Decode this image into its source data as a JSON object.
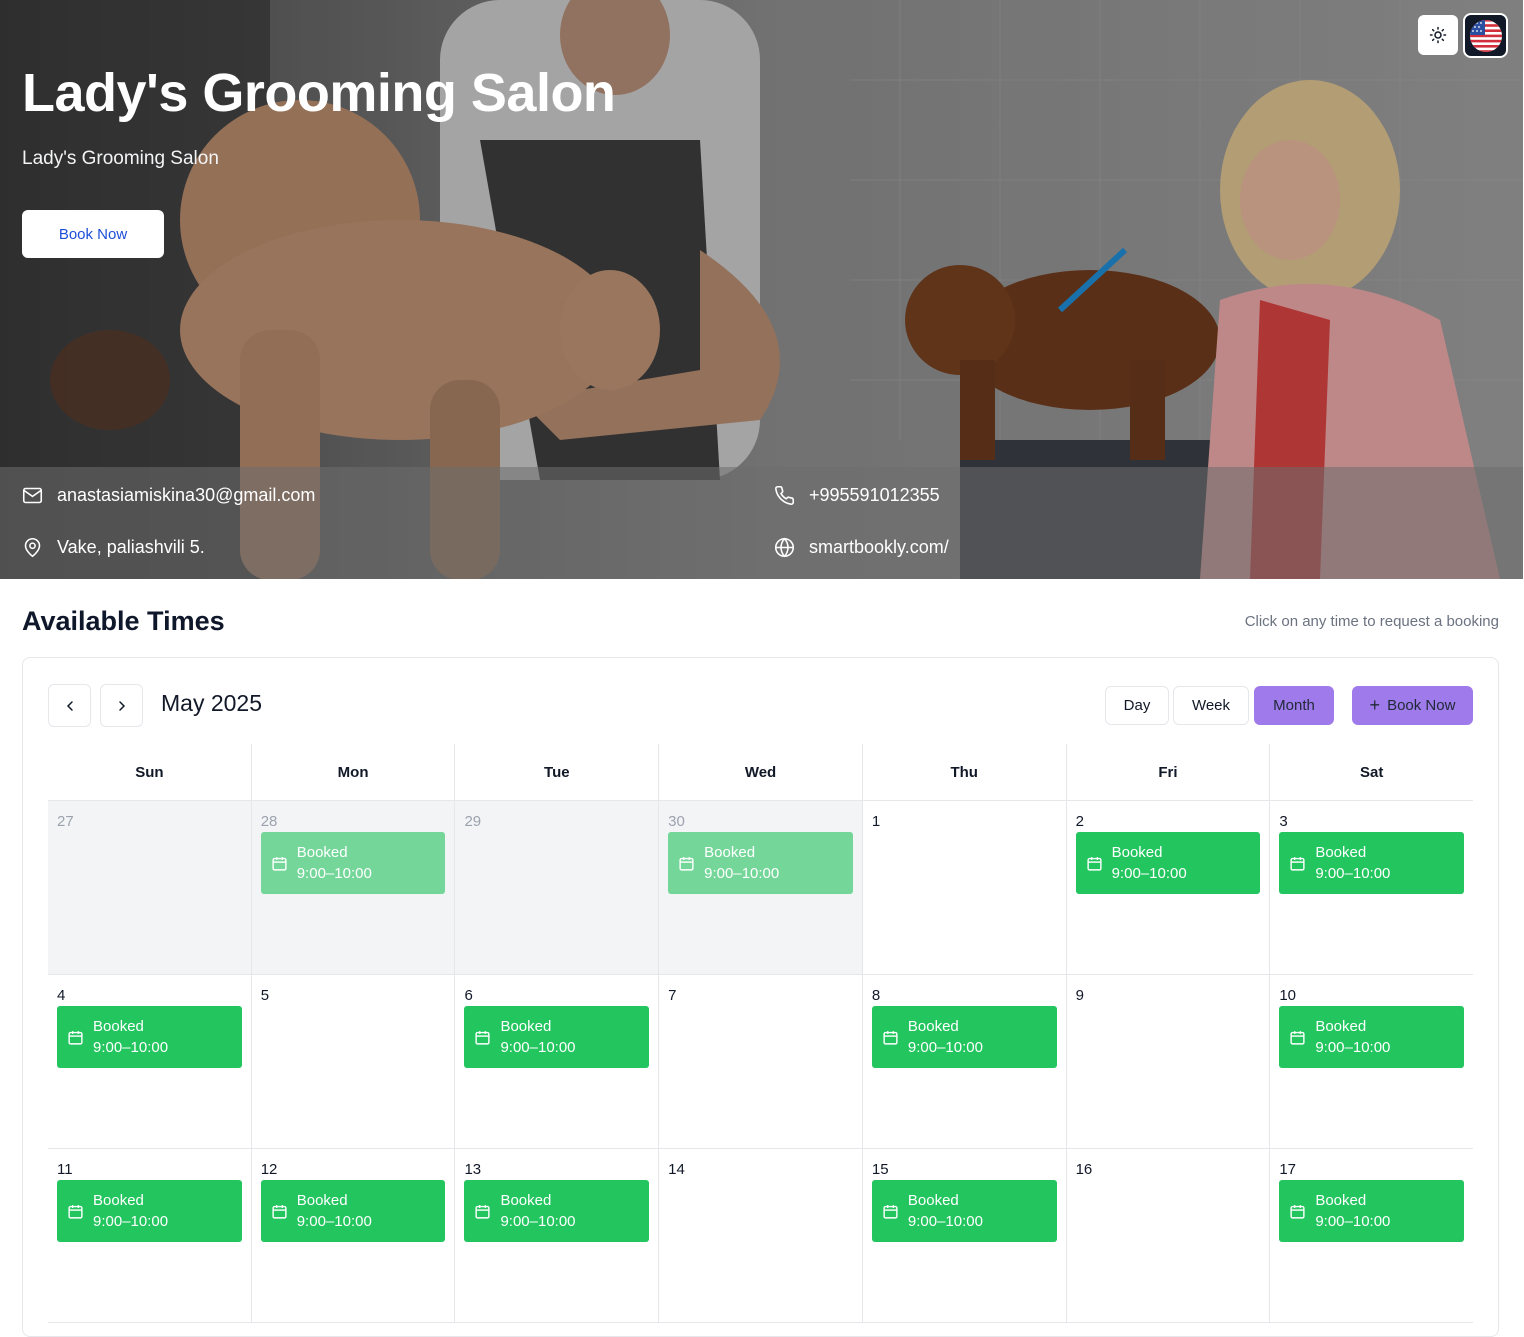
{
  "hero": {
    "title": "Lady's Grooming Salon",
    "subtitle": "Lady's Grooming Salon",
    "book_label": "Book Now"
  },
  "top_controls": {
    "theme_icon": "sun-icon",
    "language_icon": "us-flag-icon"
  },
  "contact": {
    "email": "anastasiamiskina30@gmail.com",
    "phone": "+995591012355",
    "address": "Vake, paliashvili 5.",
    "website": "smartbookly.com/"
  },
  "availability": {
    "title": "Available Times",
    "hint": "Click on any time to request a booking"
  },
  "calendar": {
    "month_label": "May 2025",
    "views": [
      "Day",
      "Week",
      "Month"
    ],
    "active_view": "Month",
    "add_label": "Book Now",
    "weekdays": [
      "Sun",
      "Mon",
      "Tue",
      "Wed",
      "Thu",
      "Fri",
      "Sat"
    ],
    "weeks": [
      [
        {
          "day": "27",
          "other": true,
          "event": null
        },
        {
          "day": "28",
          "other": true,
          "event": {
            "title": "Booked",
            "time": "9:00–10:00"
          }
        },
        {
          "day": "29",
          "other": true,
          "event": null
        },
        {
          "day": "30",
          "other": true,
          "event": {
            "title": "Booked",
            "time": "9:00–10:00"
          }
        },
        {
          "day": "1",
          "other": false,
          "event": null
        },
        {
          "day": "2",
          "other": false,
          "event": {
            "title": "Booked",
            "time": "9:00–10:00"
          }
        },
        {
          "day": "3",
          "other": false,
          "event": {
            "title": "Booked",
            "time": "9:00–10:00"
          }
        }
      ],
      [
        {
          "day": "4",
          "other": false,
          "event": {
            "title": "Booked",
            "time": "9:00–10:00"
          }
        },
        {
          "day": "5",
          "other": false,
          "event": null
        },
        {
          "day": "6",
          "other": false,
          "event": {
            "title": "Booked",
            "time": "9:00–10:00"
          }
        },
        {
          "day": "7",
          "other": false,
          "event": null
        },
        {
          "day": "8",
          "other": false,
          "event": {
            "title": "Booked",
            "time": "9:00–10:00"
          }
        },
        {
          "day": "9",
          "other": false,
          "event": null
        },
        {
          "day": "10",
          "other": false,
          "event": {
            "title": "Booked",
            "time": "9:00–10:00"
          }
        }
      ],
      [
        {
          "day": "11",
          "other": false,
          "event": {
            "title": "Booked",
            "time": "9:00–10:00"
          }
        },
        {
          "day": "12",
          "other": false,
          "event": {
            "title": "Booked",
            "time": "9:00–10:00"
          }
        },
        {
          "day": "13",
          "other": false,
          "event": {
            "title": "Booked",
            "time": "9:00–10:00"
          }
        },
        {
          "day": "14",
          "other": false,
          "event": null
        },
        {
          "day": "15",
          "other": false,
          "event": {
            "title": "Booked",
            "time": "9:00–10:00"
          }
        },
        {
          "day": "16",
          "other": false,
          "event": null
        },
        {
          "day": "17",
          "other": false,
          "event": {
            "title": "Booked",
            "time": "9:00–10:00"
          }
        }
      ]
    ]
  },
  "colors": {
    "accent": "#9f7aea",
    "booked": "#22c55e",
    "booked_faded": "#74d699",
    "link": "#1d4ed8"
  }
}
